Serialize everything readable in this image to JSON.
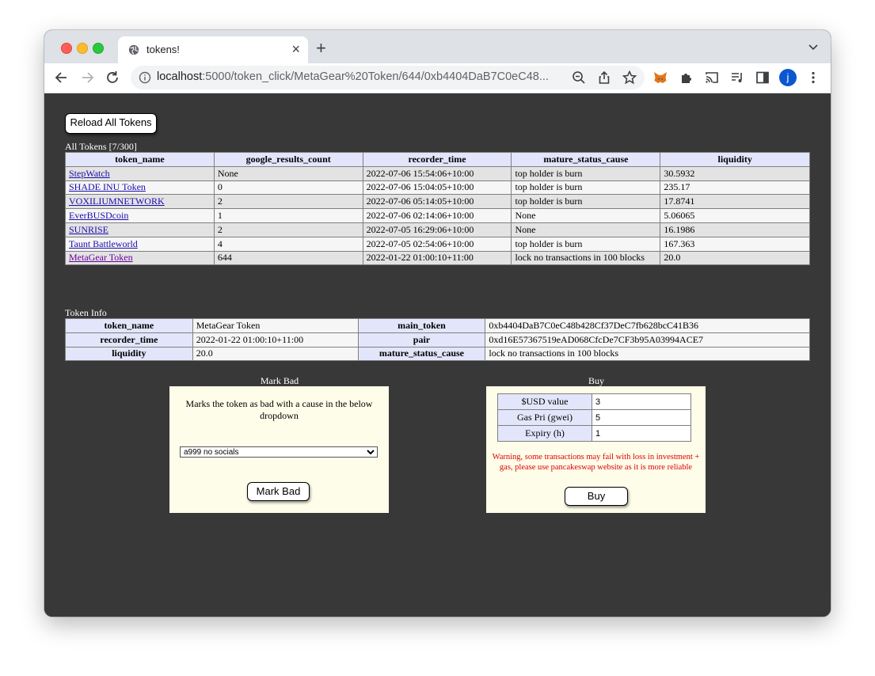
{
  "browser": {
    "tab_title": "tokens!",
    "url_host": "localhost",
    "url_rest": ":5000/token_click/MetaGear%20Token/644/0xb4404DaB7C0eC48...",
    "profile_initial": "j"
  },
  "page": {
    "reload_button": "Reload All Tokens",
    "all_tokens_caption": "All Tokens [7/300]",
    "token_table": {
      "headers": [
        "token_name",
        "google_results_count",
        "recorder_time",
        "mature_status_cause",
        "liquidity"
      ],
      "rows": [
        [
          "StepWatch",
          "None",
          "2022-07-06 15:54:06+10:00",
          "top holder is burn",
          "30.5932"
        ],
        [
          "SHADE INU Token",
          "0",
          "2022-07-06 15:04:05+10:00",
          "top holder is burn",
          "235.17"
        ],
        [
          "VOXILIUMNETWORK",
          "2",
          "2022-07-06 05:14:05+10:00",
          "top holder is burn",
          "17.8741"
        ],
        [
          "EverBUSDcoin",
          "1",
          "2022-07-06 02:14:06+10:00",
          "None",
          "5.06065"
        ],
        [
          "SUNRISE",
          "2",
          "2022-07-05 16:29:06+10:00",
          "None",
          "16.1986"
        ],
        [
          "Taunt Battleworld",
          "4",
          "2022-07-05 02:54:06+10:00",
          "top holder is burn",
          "167.363"
        ],
        [
          "MetaGear Token",
          "644",
          "2022-01-22 01:00:10+11:00",
          "lock no transactions in 100 blocks",
          "20.0"
        ]
      ]
    },
    "token_info_caption": "Token Info",
    "token_info": {
      "rows": [
        [
          "token_name",
          "MetaGear Token",
          "main_token",
          "0xb4404DaB7C0eC48b428Cf37DeC7fb628bcC41B36"
        ],
        [
          "recorder_time",
          "2022-01-22 01:00:10+11:00",
          "pair",
          "0xd16E57367519eAD068CfcDe7CF3b95A03994ACE7"
        ],
        [
          "liquidity",
          "20.0",
          "mature_status_cause",
          "lock no transactions in 100 blocks"
        ]
      ]
    },
    "mark_bad": {
      "title": "Mark Bad",
      "description": "Marks the token as bad with a cause in the below dropdown",
      "selected_cause": "a999 no socials",
      "button": "Mark Bad"
    },
    "buy": {
      "title": "Buy",
      "fields": [
        {
          "label": "$USD value",
          "value": "3"
        },
        {
          "label": "Gas Pri (gwei)",
          "value": "5"
        },
        {
          "label": "Expiry (h)",
          "value": "1"
        }
      ],
      "warning": "Warning, some transactions may fail with loss in investment + gas, please use pancakeswap website as it is more reliable",
      "button": "Buy"
    }
  },
  "colors": {
    "page_bg": "#383838",
    "header_cell_bg": "#e3e6fb",
    "panel_bg": "#fdfdea",
    "warning_text": "#e00000",
    "link": "#1a0dab",
    "visited_link": "#660099"
  }
}
